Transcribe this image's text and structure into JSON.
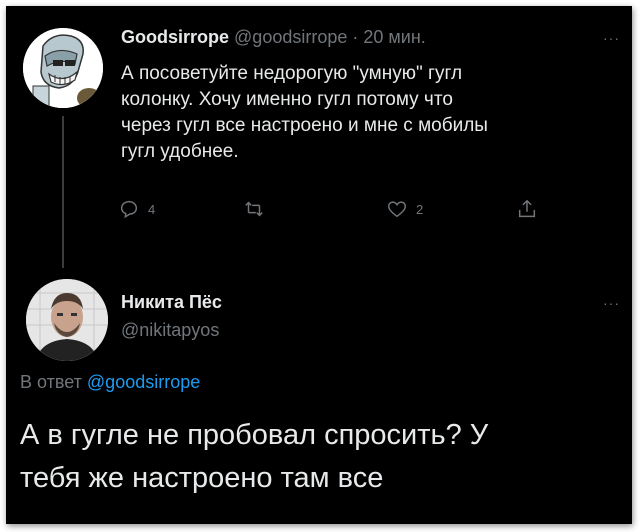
{
  "tweet": {
    "author_name": "Goodsirrope",
    "author_handle": "@goodsirrope",
    "separator": "·",
    "time": "20 мин.",
    "more_label": "···",
    "text": "А посоветуйте недорогую \"умную\" гугл\nколонку. Хочу именно гугл потому что\nчерез гугл все настроено и мне с мобилы\nгугл удобнее.",
    "reply_count": "4",
    "retweet_count": "",
    "like_count": "2"
  },
  "reply": {
    "author_name": "Никита Пёс",
    "author_handle": "@nikitapyos",
    "more_label": "···",
    "reply_prefix": "В ответ",
    "reply_target": "@goodsirrope",
    "text": "А в гугле не пробовал спросить? У\nтебя же настроено там все"
  },
  "colors": {
    "background": "#000000",
    "text": "#e7e9ea",
    "muted": "#71767b",
    "link": "#1d9bf0",
    "thread_line": "#3a3d40"
  },
  "icons": {
    "reply": "reply-icon",
    "retweet": "retweet-icon",
    "like": "heart-icon",
    "share": "share-icon",
    "more": "more-dots-icon"
  }
}
